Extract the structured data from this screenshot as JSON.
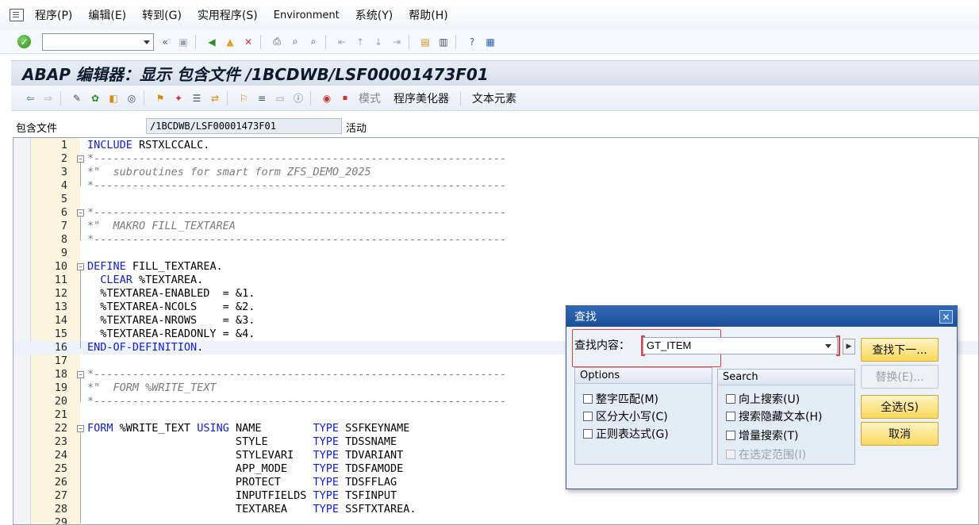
{
  "menu": {
    "items": [
      "程序(P)",
      "编辑(E)",
      "转到(G)",
      "实用程序(S)",
      "Environment",
      "系统(Y)",
      "帮助(H)"
    ]
  },
  "toolbar": {
    "command_field_value": ""
  },
  "title": "ABAP 编辑器：显示 包含文件 /1BCDWB/LSF00001473F01",
  "app_toolbar": {
    "mode_label": "模式",
    "pretty_printer_label": "程序美化器",
    "text_elements_label": "文本元素"
  },
  "include": {
    "label": "包含文件",
    "value": "/1BCDWB/LSF00001473F01",
    "status": "活动"
  },
  "code": {
    "lines": [
      {
        "n": "1",
        "t": "INCLUDE RSTXLCCALC."
      },
      {
        "n": "2",
        "t": "*----------------------------------------------------------------"
      },
      {
        "n": "3",
        "t": "*\"  subroutines for smart form ZFS_DEMO_2025"
      },
      {
        "n": "4",
        "t": "*----------------------------------------------------------------"
      },
      {
        "n": "5",
        "t": ""
      },
      {
        "n": "6",
        "t": "*----------------------------------------------------------------"
      },
      {
        "n": "7",
        "t": "*\"  MAKRO FILL_TEXTAREA"
      },
      {
        "n": "8",
        "t": "*----------------------------------------------------------------"
      },
      {
        "n": "9",
        "t": ""
      },
      {
        "n": "10",
        "t": "DEFINE FILL_TEXTAREA."
      },
      {
        "n": "11",
        "t": "  CLEAR %TEXTAREA."
      },
      {
        "n": "12",
        "t": "  %TEXTAREA-ENABLED  = &1."
      },
      {
        "n": "13",
        "t": "  %TEXTAREA-NCOLS    = &2."
      },
      {
        "n": "14",
        "t": "  %TEXTAREA-NROWS    = &3."
      },
      {
        "n": "15",
        "t": "  %TEXTAREA-READONLY = &4."
      },
      {
        "n": "16",
        "t": "END-OF-DEFINITION."
      },
      {
        "n": "17",
        "t": ""
      },
      {
        "n": "18",
        "t": "*----------------------------------------------------------------"
      },
      {
        "n": "19",
        "t": "*\"  FORM %WRITE_TEXT"
      },
      {
        "n": "20",
        "t": "*----------------------------------------------------------------"
      },
      {
        "n": "21",
        "t": ""
      },
      {
        "n": "22",
        "t": "FORM %WRITE_TEXT USING NAME        TYPE SSFKEYNAME"
      },
      {
        "n": "23",
        "t": "                       STYLE       TYPE TDSSNAME"
      },
      {
        "n": "24",
        "t": "                       STYLEVARI   TYPE TDVARIANT"
      },
      {
        "n": "25",
        "t": "                       APP_MODE    TYPE TDSFAMODE"
      },
      {
        "n": "26",
        "t": "                       PROTECT     TYPE TDSFFLAG"
      },
      {
        "n": "27",
        "t": "                       INPUTFIELDS TYPE TSFINPUT"
      },
      {
        "n": "28",
        "t": "                       TEXTAREA    TYPE SSFTXTAREA."
      },
      {
        "n": "29",
        "t": ""
      }
    ]
  },
  "find_dialog": {
    "title": "查找",
    "find_label": "查找内容：",
    "find_value": "GT_ITEM",
    "find_next_label": "查找下一...",
    "replace_label": "替换(E)...",
    "select_all_label": "全选(S)",
    "cancel_label": "取消",
    "options_title": "Options",
    "options": [
      "整字匹配(M)",
      "区分大小写(C)",
      "正则表达式(G)"
    ],
    "search_title": "Search",
    "search_opts": [
      "向上搜索(U)",
      "搜索隐藏文本(H)",
      "增量搜索(T)",
      "在选定范围(I)"
    ]
  },
  "colors": {
    "keyword": "#1220c8",
    "comment": "#7a7a7a",
    "title_bar": "#1c4f96",
    "button": "#f9d95c"
  }
}
